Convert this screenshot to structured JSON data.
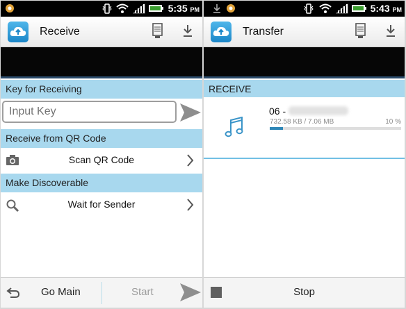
{
  "status": {
    "left_time": "5:35",
    "left_ampm": "PM",
    "right_time": "5:43",
    "right_ampm": "PM"
  },
  "receive_screen": {
    "title": "Receive",
    "icons": [
      "server-icon",
      "download-icon"
    ],
    "key_section": "Key for Receiving",
    "key_placeholder": "Input Key",
    "qr_section": "Receive from QR Code",
    "scan_label": "Scan QR Code",
    "discover_section": "Make Discoverable",
    "wait_label": "Wait for Sender",
    "footer": {
      "go_main": "Go Main",
      "start": "Start"
    }
  },
  "transfer_screen": {
    "title": "Transfer",
    "section": "RECEIVE",
    "item": {
      "name_prefix": "06 -",
      "size": "732.58 KB / 7.06 MB",
      "percent_label": "10 %",
      "progress": 0.1
    },
    "footer": {
      "stop": "Stop"
    }
  },
  "colors": {
    "section_bg": "#a8d8ee",
    "accent": "#2e86b6",
    "disabled_text": "#9c9c9c"
  }
}
